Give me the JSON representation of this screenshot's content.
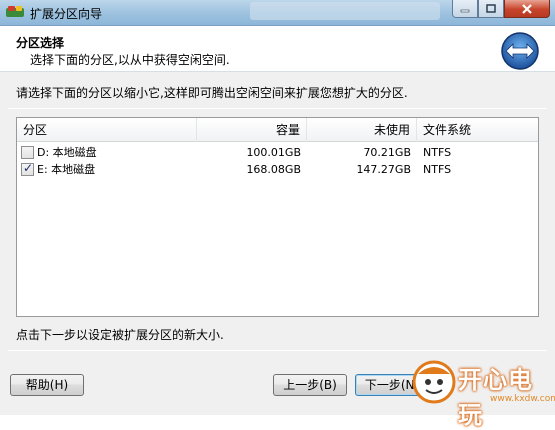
{
  "window": {
    "title": "扩展分区向导"
  },
  "header": {
    "title": "分区选择",
    "subtitle": "选择下面的分区,以从中获得空闲空间.",
    "icon": "expand-arrows-icon"
  },
  "instruction": "请选择下面的分区以缩小它,这样即可腾出空闲空间来扩展您想扩大的分区.",
  "partition_list": {
    "columns": [
      "分区",
      "容量",
      "未使用",
      "文件系统"
    ],
    "rows": [
      {
        "checked": false,
        "name": "D: 本地磁盘",
        "capacity": "100.01GB",
        "unused": "70.21GB",
        "filesystem": "NTFS"
      },
      {
        "checked": true,
        "name": "E: 本地磁盘",
        "capacity": "168.08GB",
        "unused": "147.27GB",
        "filesystem": "NTFS"
      }
    ]
  },
  "hint": "点击下一步以设定被扩展分区的新大小.",
  "buttons": {
    "help": "帮助(H)",
    "back": "上一步(B)",
    "next": "下一步(N)"
  },
  "watermark": {
    "text": "开心电玩",
    "url": "www.kxdw.com"
  }
}
